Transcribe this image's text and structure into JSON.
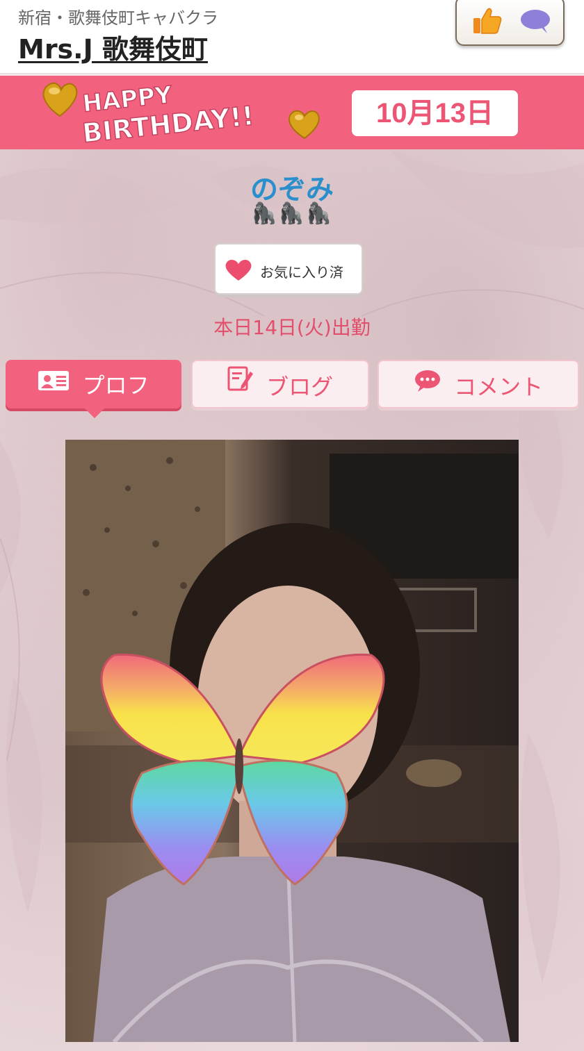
{
  "header": {
    "area_label": "新宿・歌舞伎町キャバクラ",
    "shop_name": "Mrs.J 歌舞伎町"
  },
  "birthday_banner": {
    "art_line1": "HAPPY",
    "art_line2": "BIRTHDAY!!",
    "date": "10月13日"
  },
  "profile": {
    "name": "のぞみ",
    "emoji": "🦍🦍🦍",
    "favorite_label": "お気に入り済",
    "work_status": "本日14日(火)出勤"
  },
  "tabs": [
    {
      "label": "プロフ",
      "active": true
    },
    {
      "label": "ブログ",
      "active": false
    },
    {
      "label": "コメント",
      "active": false
    }
  ],
  "colors": {
    "accent_pink": "#f2627f",
    "name_blue": "#2a8fcc",
    "status_red": "#e24f6c"
  },
  "icons": [
    "thumbs-up-icon",
    "speech-bubble-icon",
    "heart-icon",
    "profile-card-icon",
    "blog-edit-icon",
    "comment-bubble-icon",
    "gold-heart-icon"
  ]
}
